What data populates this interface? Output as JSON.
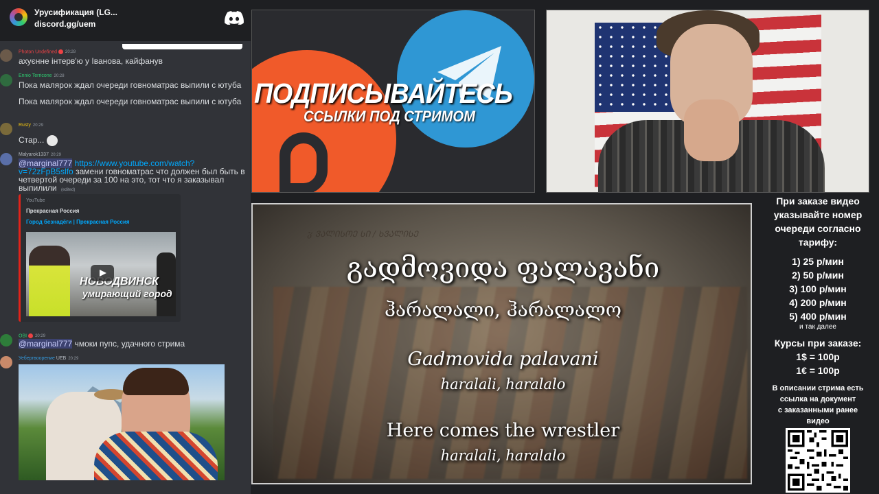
{
  "discord": {
    "server_name": "Урусификация (LG...",
    "invite": "discord.gg/uem",
    "messages": [
      {
        "user": "Photon Undefined",
        "time": "20:28",
        "color": "#ed4245",
        "lines": [
          "ахуєнне інтерв'ю у Іванова, кайфанув"
        ]
      },
      {
        "user": "Ennio Terricone",
        "time": "20:28",
        "color": "#2ecc71",
        "lines": [
          "Пока малярок ждал очереди говноматрас выпили с ютуба",
          "Пока малярок ждал очереди говноматрас выпили с ютуба"
        ]
      },
      {
        "user": "Rusty",
        "time": "20:29",
        "color": "#f1c40f",
        "lines": [
          "Стар..."
        ]
      },
      {
        "user": "Malyarok1337",
        "time": "20:29",
        "color": "#b5bac1",
        "mention": "@marginal777",
        "link": "https://www.youtube.com/watch?v=72zFpB5slfo",
        "rest": "замени говноматрас что должен был быть в четвертой очереди за 100 на это, тот что я заказывал выпилили",
        "edited": "(edited)"
      },
      {
        "user": "OBI",
        "time": "20:29",
        "color": "#2ecc71",
        "mention": "@marginal777",
        "rest": "чмоки пупс, удачного стрима"
      },
      {
        "user": "Уебергвоорение",
        "time": "20:29",
        "color": "#3498db",
        "tag": "UEB"
      }
    ],
    "embed": {
      "provider": "YouTube",
      "author": "Прекрасная Россия",
      "title": "Город безнадёги | Прекрасная Россия",
      "thumb_title": "НОВОДВИНСК",
      "thumb_subtitle": "умирающий город"
    }
  },
  "promo": {
    "title": "ПОДПИСЫВАЙТЕСЬ",
    "subtitle": "ССЫЛКИ ПОД СТРИМОМ",
    "telegram_color": "#2f97d4",
    "boosty_color": "#f05a2a"
  },
  "video": {
    "handwriting": "ჳ ᲕᲐᲚᲘᲡᲝᲔ ᲡᲘ / ᲮᲕᲐᲚᲘᲡᲔ",
    "georgian_line1": "გადმოვიდა ფალავანი",
    "georgian_line2": "ჰარალალი, ჰარალალო",
    "latin_line1": "Gadmovida palavani",
    "latin_line2": "haralali, haralalo",
    "english_line1": "Here comes the wrestler",
    "english_line2": "haralali, haralalo"
  },
  "info": {
    "heading": [
      "При заказе видео",
      "указывайте номер",
      "очереди согласно",
      "тарифу:"
    ],
    "tariffs": [
      "1) 25 р/мин",
      "2) 50 р/мин",
      "3) 100 р/мин",
      "4) 200 р/мин",
      "5) 400 р/мин"
    ],
    "and_more": "и так далее",
    "rates_heading": "Курсы при заказе:",
    "rates": [
      "1$ = 100р",
      "1€ = 100р"
    ],
    "note": [
      "В описании стрима есть",
      "ссылка на документ",
      "с заказанными ранее",
      "видео"
    ]
  }
}
